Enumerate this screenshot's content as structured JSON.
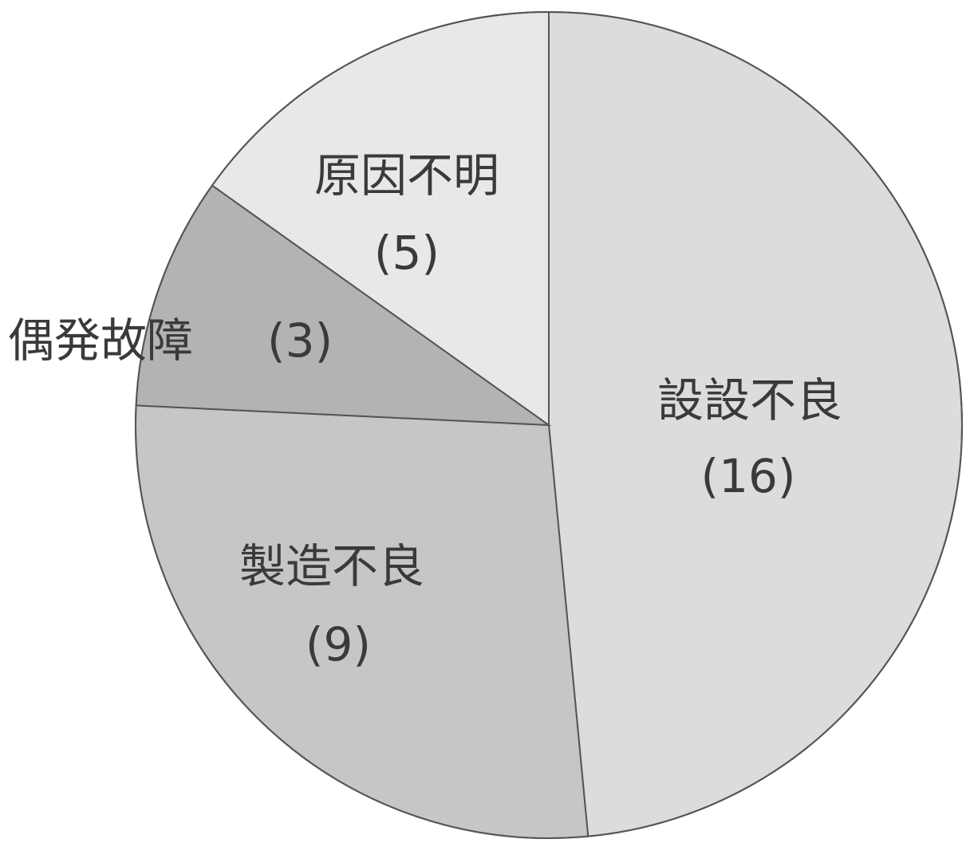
{
  "chart_data": {
    "type": "pie",
    "title": "",
    "slices": [
      {
        "label": "設設不良",
        "value": 16,
        "value_text": "(16)",
        "color": "#dcdcdc"
      },
      {
        "label": "製造不良",
        "value": 9,
        "value_text": "(9)",
        "color": "#c6c6c6"
      },
      {
        "label": "偶発故障",
        "value": 3,
        "value_text": "(3)",
        "color": "#b3b3b3"
      },
      {
        "label": "原因不明",
        "value": 5,
        "value_text": "(5)",
        "color": "#e8e8e8"
      }
    ],
    "start_angle": "top",
    "direction": "clockwise",
    "legend": "none",
    "labels_position": "inside"
  }
}
